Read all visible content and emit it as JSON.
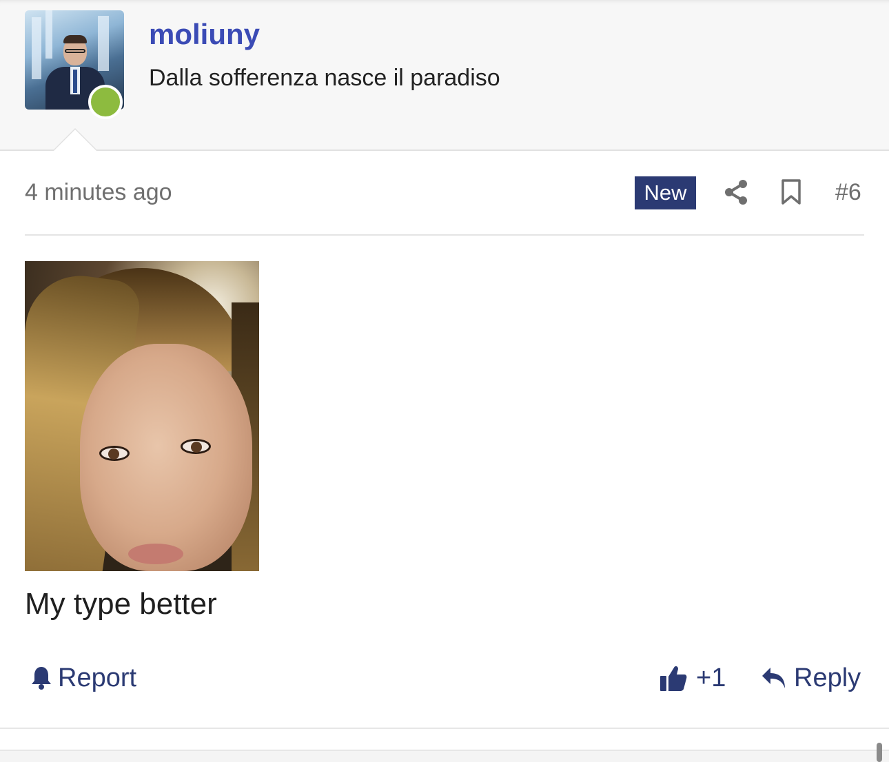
{
  "user": {
    "name": "moliuny",
    "title": "Dalla sofferenza nasce il paradiso",
    "online": true,
    "online_color": "#8dbb3f",
    "name_color": "#3b4bb5"
  },
  "post": {
    "timestamp": "4 minutes ago",
    "badge": "New",
    "number": "#6",
    "text": "My type better",
    "accent_color": "#2b3a73"
  },
  "actions": {
    "report_label": "Report",
    "like_label": "+1",
    "reply_label": "Reply"
  },
  "icons": [
    "share-icon",
    "bookmark-icon",
    "bell-icon",
    "thumbs-up-icon",
    "reply-arrow-icon"
  ]
}
